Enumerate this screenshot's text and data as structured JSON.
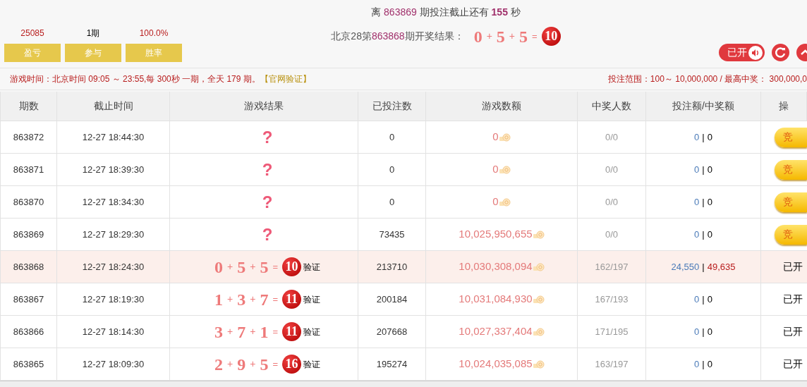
{
  "countdown": {
    "prefix": "离",
    "issue": "863869",
    "middle": "期投注截止还有",
    "seconds": "155",
    "suffix": "秒"
  },
  "stats": [
    {
      "value": "25085",
      "label": "盈亏",
      "emphasis": true
    },
    {
      "value": "1期",
      "label": "参与",
      "emphasis": false
    },
    {
      "value": "100.0%",
      "label": "胜率",
      "emphasis": true
    }
  ],
  "last_result": {
    "prefix": "北京28第",
    "issue": "863868",
    "suffix": "期开奖结果：",
    "numbers": [
      "0",
      "5",
      "5"
    ],
    "operators": [
      "+",
      "+",
      "="
    ],
    "sum": "10"
  },
  "sound_toggle": {
    "label": "已开",
    "on": true
  },
  "info": {
    "game_time": "游戏时间：北京时间 09:05 ～ 23:55,每 300秒 一期，全天 179 期。",
    "verify_link": "【官网验证】",
    "range": "投注范围：100～ 10,000,000 / 最高中奖： 300,000,0"
  },
  "table": {
    "columns": [
      "期数",
      "截止时间",
      "游戏结果",
      "已投注数",
      "游戏数额",
      "中奖人数",
      "投注额/中奖额",
      "操"
    ],
    "rows": [
      {
        "issue": "863872",
        "deadline": "12-27 18:44:30",
        "result": {
          "kind": "pending",
          "mark": "?"
        },
        "bets": "0",
        "pool": "0",
        "winners": "0/0",
        "bet": "0",
        "sep": "|",
        "win": "0",
        "won": false,
        "highlighted": false,
        "action": {
          "kind": "button",
          "label": "竞"
        }
      },
      {
        "issue": "863871",
        "deadline": "12-27 18:39:30",
        "result": {
          "kind": "pending",
          "mark": "?"
        },
        "bets": "0",
        "pool": "0",
        "winners": "0/0",
        "bet": "0",
        "sep": "|",
        "win": "0",
        "won": false,
        "highlighted": false,
        "action": {
          "kind": "button",
          "label": "竞"
        }
      },
      {
        "issue": "863870",
        "deadline": "12-27 18:34:30",
        "result": {
          "kind": "pending",
          "mark": "?"
        },
        "bets": "0",
        "pool": "0",
        "winners": "0/0",
        "bet": "0",
        "sep": "|",
        "win": "0",
        "won": false,
        "highlighted": false,
        "action": {
          "kind": "button",
          "label": "竞"
        }
      },
      {
        "issue": "863869",
        "deadline": "12-27 18:29:30",
        "result": {
          "kind": "pending",
          "mark": "?"
        },
        "bets": "73435",
        "pool": "10,025,950,655",
        "winners": "0/0",
        "bet": "0",
        "sep": "|",
        "win": "0",
        "won": false,
        "highlighted": false,
        "action": {
          "kind": "button",
          "label": "竞"
        }
      },
      {
        "issue": "863868",
        "deadline": "12-27 18:24:30",
        "result": {
          "kind": "drawn",
          "numbers": [
            "0",
            "5",
            "5"
          ],
          "operators": [
            "+",
            "+",
            "="
          ],
          "sum": "10",
          "verify": "验证"
        },
        "bets": "213710",
        "pool": "10,030,308,094",
        "winners": "162/197",
        "bet": "24,550",
        "sep": "|",
        "win": "49,635",
        "won": true,
        "highlighted": true,
        "action": {
          "kind": "status",
          "label": "已开"
        }
      },
      {
        "issue": "863867",
        "deadline": "12-27 18:19:30",
        "result": {
          "kind": "drawn",
          "numbers": [
            "1",
            "3",
            "7"
          ],
          "operators": [
            "+",
            "+",
            "="
          ],
          "sum": "11",
          "verify": "验证"
        },
        "bets": "200184",
        "pool": "10,031,084,930",
        "winners": "167/193",
        "bet": "0",
        "sep": "|",
        "win": "0",
        "won": false,
        "highlighted": false,
        "action": {
          "kind": "status",
          "label": "已开"
        }
      },
      {
        "issue": "863866",
        "deadline": "12-27 18:14:30",
        "result": {
          "kind": "drawn",
          "numbers": [
            "3",
            "7",
            "1"
          ],
          "operators": [
            "+",
            "+",
            "="
          ],
          "sum": "11",
          "verify": "验证"
        },
        "bets": "207668",
        "pool": "10,027,337,404",
        "winners": "171/195",
        "bet": "0",
        "sep": "|",
        "win": "0",
        "won": false,
        "highlighted": false,
        "action": {
          "kind": "status",
          "label": "已开"
        }
      },
      {
        "issue": "863865",
        "deadline": "12-27 18:09:30",
        "result": {
          "kind": "drawn",
          "numbers": [
            "2",
            "9",
            "5"
          ],
          "operators": [
            "+",
            "+",
            "="
          ],
          "sum": "16",
          "verify": "验证"
        },
        "bets": "195274",
        "pool": "10,024,035,085",
        "winners": "163/197",
        "bet": "0",
        "sep": "|",
        "win": "0",
        "won": false,
        "highlighted": false,
        "action": {
          "kind": "status",
          "label": "已开"
        }
      }
    ]
  }
}
